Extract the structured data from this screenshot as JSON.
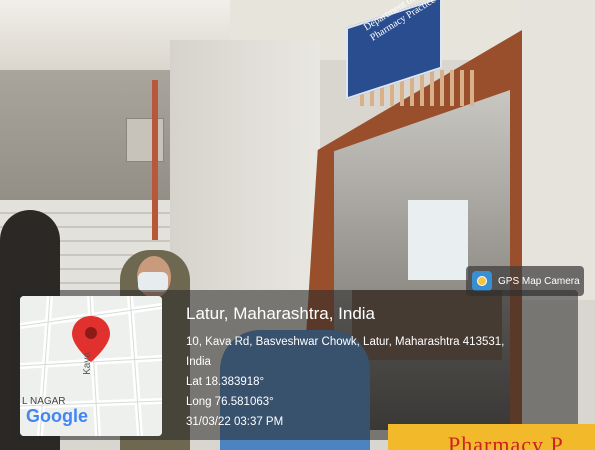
{
  "sign": {
    "line1": "Department of",
    "line2": "Pharmacy Practice"
  },
  "badge": {
    "label": "GPS Map Camera",
    "icon": "camera-icon"
  },
  "location": {
    "title": "Latur, Maharashtra, India",
    "address1": "10, Kava Rd, Basveshwar Chowk, Latur, Maharashtra 413531,",
    "address2": "India",
    "lat": "Lat 18.383918°",
    "long": "Long 76.581063°",
    "datetime": "31/03/22 03:37 PM"
  },
  "map": {
    "road_label": "Kava",
    "area_label": "L NAGAR",
    "logo": "Google",
    "pin_color": "#e0312e"
  },
  "banner": {
    "text": "Pharmacy P"
  }
}
